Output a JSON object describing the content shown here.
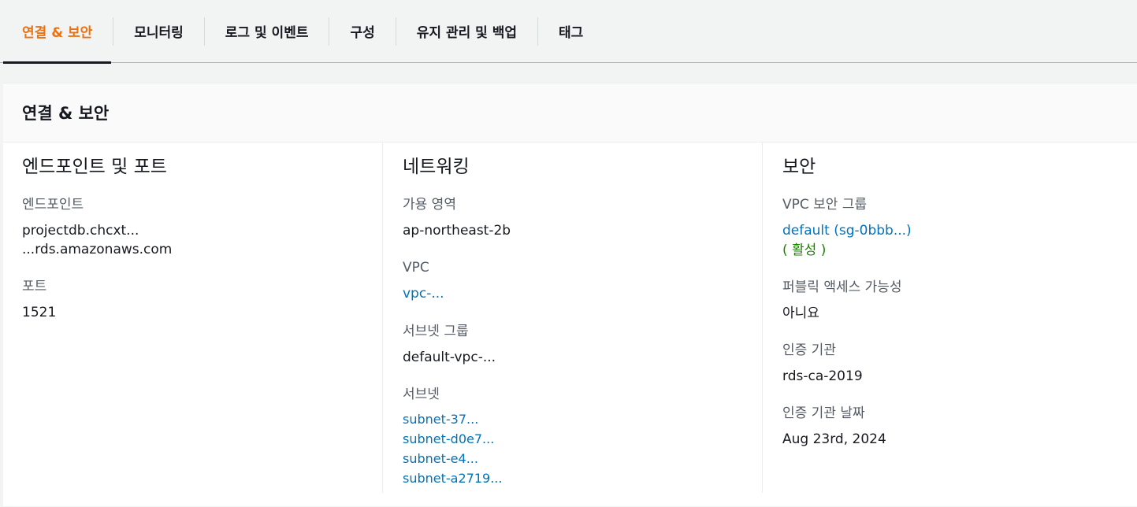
{
  "tabs": [
    {
      "label": "연결 & 보안",
      "active": true
    },
    {
      "label": "모니터링"
    },
    {
      "label": "로그 및 이벤트"
    },
    {
      "label": "구성"
    },
    {
      "label": "유지 관리 및 백업"
    },
    {
      "label": "태그"
    }
  ],
  "panel": {
    "title": "연결 & 보안",
    "endpoint_section": {
      "title": "엔드포인트 및 포트",
      "endpoint_label": "엔드포인트",
      "endpoint_value_line1": "projectdb.chcxt...",
      "endpoint_value_line2": "...rds.amazonaws.com",
      "port_label": "포트",
      "port_value": "1521"
    },
    "networking_section": {
      "title": "네트워킹",
      "az_label": "가용 영역",
      "az_value": "ap-northeast-2b",
      "vpc_label": "VPC",
      "vpc_value": "vpc-...",
      "subnet_group_label": "서브넷 그룹",
      "subnet_group_value": "default-vpc-...",
      "subnets_label": "서브넷",
      "subnets": [
        "subnet-37...",
        "subnet-d0e7...",
        "subnet-e4...",
        "subnet-a2719..."
      ]
    },
    "security_section": {
      "title": "보안",
      "sg_label": "VPC 보안 그룹",
      "sg_value": "default (sg-0bbb...)",
      "sg_status": "( 활성 )",
      "public_label": "퍼블릭 액세스 가능성",
      "public_value": "아니요",
      "ca_label": "인증 기관",
      "ca_value": "rds-ca-2019",
      "ca_date_label": "인증 기관 날짜",
      "ca_date_value": "Aug 23rd, 2024"
    }
  },
  "colors": {
    "active_tab": "#ec7211",
    "link": "#0073bb",
    "status_ok": "#1d8102"
  }
}
